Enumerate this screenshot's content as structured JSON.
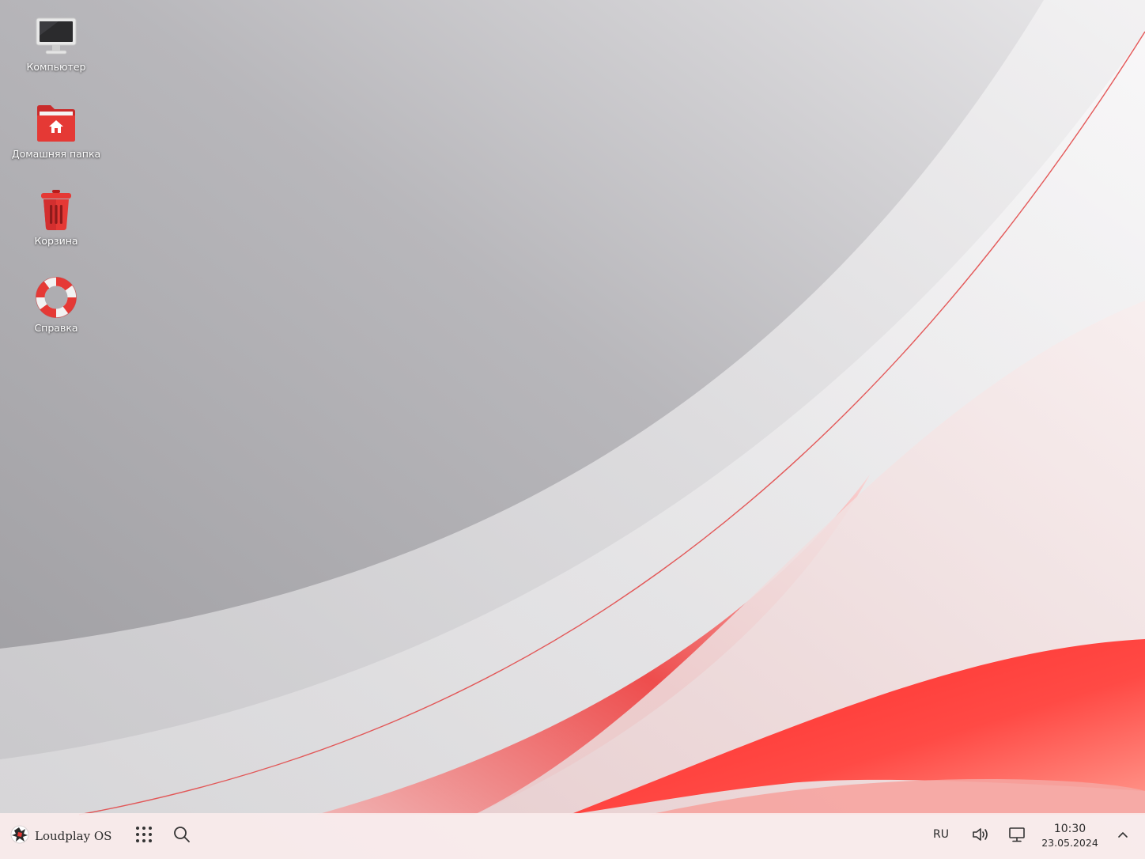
{
  "desktop": {
    "icons": [
      {
        "label": "Компьютер",
        "icon": "computer-icon"
      },
      {
        "label": "Домашняя папка",
        "icon": "home-folder-icon"
      },
      {
        "label": "Корзина",
        "icon": "trash-icon"
      },
      {
        "label": "Справка",
        "icon": "help-lifebuoy-icon"
      }
    ]
  },
  "taskbar": {
    "start_label": "Loudplay OS",
    "apps_icon": "app-grid-icon",
    "search_icon": "search-icon",
    "language": "RU",
    "volume_icon": "volume-icon",
    "display_icon": "display-icon",
    "time": "10:30",
    "date": "23.05.2024",
    "tray_expand_icon": "chevron-up-icon"
  },
  "colors": {
    "accent": "#e53935",
    "wallpaper_gray": "#a8a7ab",
    "taskbar_bg": "#faecec"
  }
}
